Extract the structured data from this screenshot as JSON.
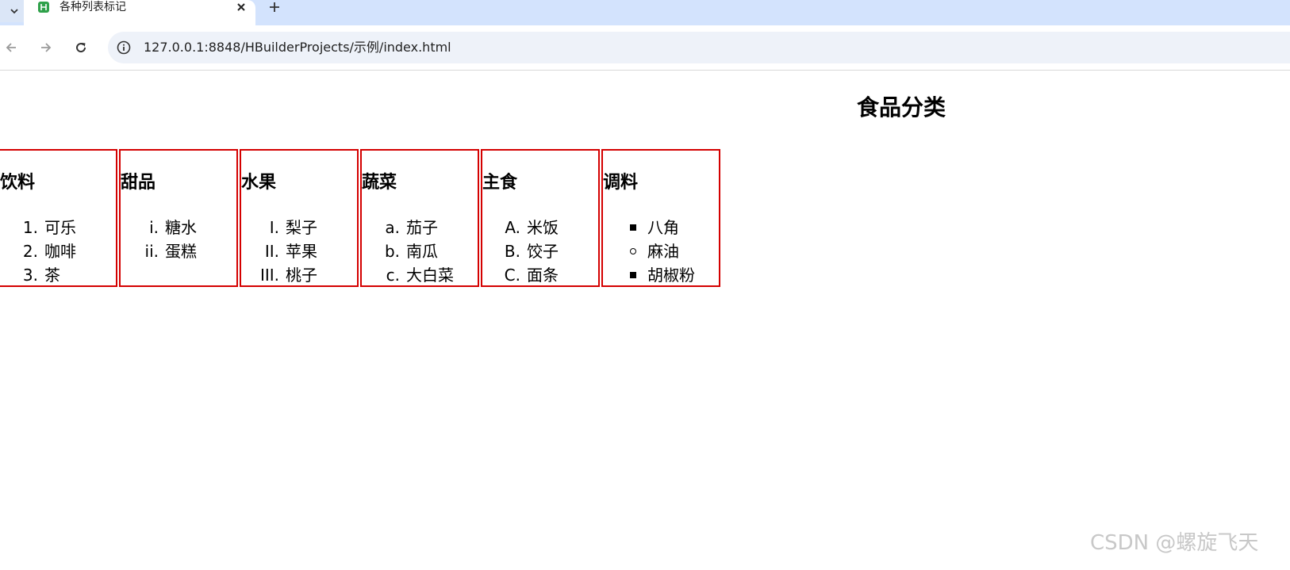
{
  "browser": {
    "tab": {
      "title": "各种列表标记"
    },
    "address": {
      "url": "127.0.0.1:8848/HBuilderProjects/示例/index.html"
    }
  },
  "page": {
    "title": "食品分类",
    "categories": [
      {
        "heading": "饮料",
        "list_type": "decimal",
        "items": [
          {
            "marker": "1.",
            "text": "可乐"
          },
          {
            "marker": "2.",
            "text": "咖啡"
          },
          {
            "marker": "3.",
            "text": "茶"
          }
        ]
      },
      {
        "heading": "甜品",
        "list_type": "lower-roman",
        "items": [
          {
            "marker": "i.",
            "text": "糖水"
          },
          {
            "marker": "ii.",
            "text": "蛋糕"
          }
        ]
      },
      {
        "heading": "水果",
        "list_type": "upper-roman",
        "items": [
          {
            "marker": "I.",
            "text": "梨子"
          },
          {
            "marker": "II.",
            "text": "苹果"
          },
          {
            "marker": "III.",
            "text": "桃子"
          }
        ]
      },
      {
        "heading": "蔬菜",
        "list_type": "lower-alpha",
        "items": [
          {
            "marker": "a.",
            "text": "茄子"
          },
          {
            "marker": "b.",
            "text": "南瓜"
          },
          {
            "marker": "c.",
            "text": "大白菜"
          }
        ]
      },
      {
        "heading": "主食",
        "list_type": "upper-alpha",
        "items": [
          {
            "marker": "A.",
            "text": "米饭"
          },
          {
            "marker": "B.",
            "text": "饺子"
          },
          {
            "marker": "C.",
            "text": "面条"
          }
        ]
      },
      {
        "heading": "调料",
        "list_type": "bullets",
        "items": [
          {
            "bullet": "square",
            "text": "八角"
          },
          {
            "bullet": "circle",
            "text": "麻油"
          },
          {
            "bullet": "square",
            "text": "胡椒粉"
          }
        ]
      }
    ]
  },
  "watermark": "CSDN @螺旋飞天",
  "colors": {
    "cell_border": "#d40000",
    "tabstrip": "#d3e3fd",
    "favicon": "#2fa14a"
  }
}
